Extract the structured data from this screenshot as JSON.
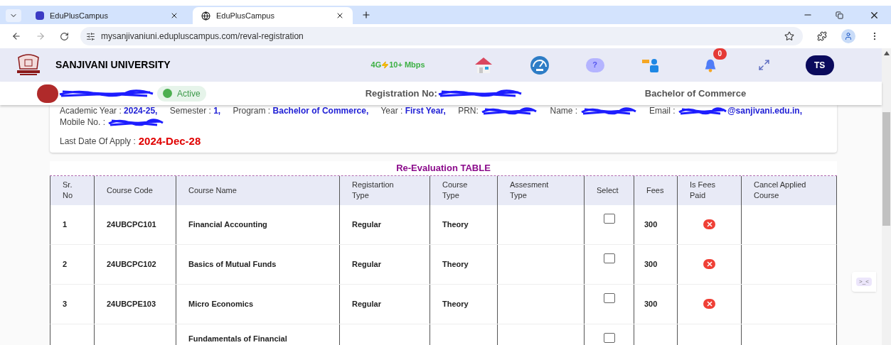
{
  "browser": {
    "tabs": [
      {
        "title": "EduPlusCampus",
        "selected": false
      },
      {
        "title": "EduPlusCampus",
        "selected": true
      }
    ],
    "url": "mysanjivaniuni.edupluscampus.com/reval-registration"
  },
  "header": {
    "university": "SANJIVANI UNIVERSITY",
    "network": "4G",
    "speed": "10+ Mbps",
    "help_symbol": "?",
    "notification_count": "0",
    "avatar": "TS"
  },
  "student_bar": {
    "status": "Active",
    "registration_label": "Registration No:",
    "program": "Bachelor of Commerce"
  },
  "info": {
    "fields": [
      {
        "label": "Academic Year :",
        "value": "2024-25,",
        "redacted": false
      },
      {
        "label": "Semester :",
        "value": "1,",
        "redacted": false
      },
      {
        "label": "Program :",
        "value": "Bachelor of Commerce,",
        "redacted": false
      },
      {
        "label": "Year :",
        "value": "First Year,",
        "redacted": false
      },
      {
        "label": "PRN:",
        "redacted": true
      },
      {
        "label": "Name :",
        "redacted": true
      },
      {
        "label": "Email :",
        "value": "@sanjivani.edu.in,",
        "redacted": true
      },
      {
        "label": "Mobile No. :",
        "redacted": true
      }
    ],
    "deadline_label": "Last Date Of Apply :",
    "deadline": "2024-Dec-28"
  },
  "table": {
    "title": "Re-Evaluation TABLE",
    "columns": [
      "Sr. No",
      "Course Code",
      "Course Name",
      "Registartion Type",
      "Course Type",
      "Assesment Type",
      "Select",
      "Fees",
      "Is Fees Paid",
      "Cancel Applied Course"
    ],
    "rows": [
      {
        "sr": "1",
        "code": "24UBCPC101",
        "name": "Financial Accounting",
        "registration_type": "Regular",
        "course_type": "Theory",
        "selected": false,
        "fees": "300",
        "fees_paid": false
      },
      {
        "sr": "2",
        "code": "24UBCPC102",
        "name": "Basics of Mutual Funds",
        "registration_type": "Regular",
        "course_type": "Theory",
        "selected": false,
        "fees": "300",
        "fees_paid": false
      },
      {
        "sr": "3",
        "code": "24UBCPE103",
        "name": "Micro Economics",
        "registration_type": "Regular",
        "course_type": "Theory",
        "selected": false,
        "fees": "300",
        "fees_paid": false
      },
      {
        "name": "Fundamentals of Financial",
        "selected": false
      }
    ]
  },
  "widget_label": ">_<"
}
